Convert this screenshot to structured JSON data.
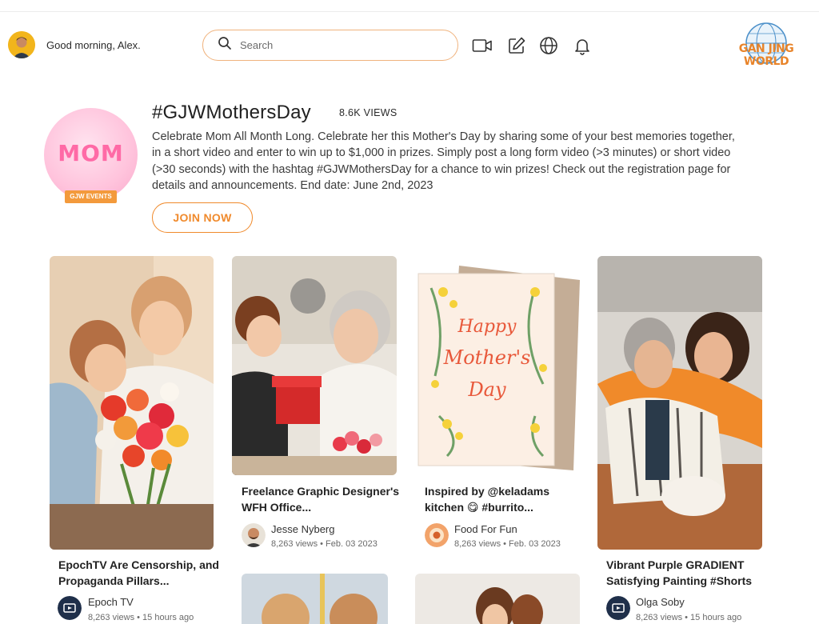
{
  "header": {
    "greeting": "Good morning, Alex.",
    "search_placeholder": "Search",
    "icons": [
      "video-icon",
      "edit-icon",
      "globe-icon",
      "bell-icon"
    ],
    "logo_text": "GAN JING WORLD"
  },
  "event": {
    "badge_word": "MOM",
    "badge_tag": "GJW EVENTS",
    "title": "#GJWMothersDay",
    "views": "8.6K VIEWS",
    "description": "Celebrate Mom All Month Long. Celebrate her this Mother's Day by sharing some of your best memories together, in a short video and enter to win up to $1,000 in prizes. Simply post a long form video (>3 minutes) or short video (>30 seconds) with the hashtag #GJWMothersDay for a chance to win prizes! Check out the registration page for details and announcements. End date: June 2nd, 2023",
    "join_label": "JOIN NOW"
  },
  "cards": [
    {
      "title": "EpochTV Are Censorship, and Propaganda Pillars...",
      "channel": "Epoch TV",
      "meta": "8,263 views • 15 hours ago"
    },
    {
      "title": "Freelance Graphic Designer's WFH Office...",
      "channel": "Jesse Nyberg",
      "meta": "8,263 views • Feb. 03 2023"
    },
    {
      "title": "Inspired by @keladams kitchen 😋 #burrito...",
      "channel": "Food For Fun",
      "meta": "8,263 views • Feb. 03 2023"
    },
    {
      "title": "Vibrant Purple GRADIENT Satisfying Painting #Shorts",
      "channel": "Olga Soby",
      "meta": "8,263 views • 15 hours ago"
    }
  ],
  "greeting_card_text": [
    "Happy",
    "Mother's",
    "Day"
  ],
  "colors": {
    "accent": "#f08a2c",
    "search_border": "#f0b37e",
    "badge_pink": "#ffc3dc"
  }
}
